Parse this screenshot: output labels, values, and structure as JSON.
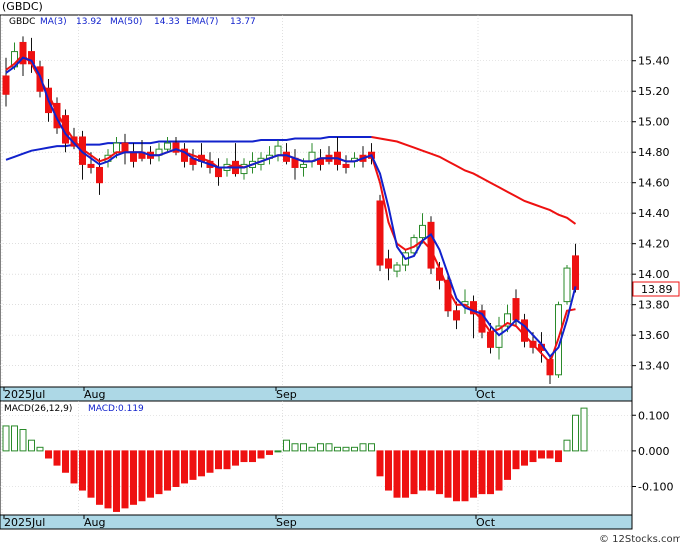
{
  "header": {
    "ticker": "(GBDC)",
    "symbol": "GBDC",
    "ma3_label": "MA(3)",
    "ma3_value": "13.92",
    "ma50_label": "MA(50)",
    "ma50_value": "14.33",
    "ema7_label": "EMA(7)",
    "ema7_value": "13.77"
  },
  "last_price_badge": "13.89",
  "macd_header": {
    "label": "MACD(26,12,9)",
    "value_label": "MACD:0.119"
  },
  "watermark": "© 12Stocks.com",
  "colors": {
    "up": "#2a8a2a",
    "down": "#ee1111",
    "ma_blue": "#1122cc",
    "ma_red": "#ee1111",
    "axis_band": "#add8e6",
    "grid": "#cccccc",
    "badge_border": "#ee1111"
  },
  "chart_data": [
    {
      "type": "candlestick",
      "title": "(GBDC)",
      "x_labels": [
        "2025Jul",
        "Aug",
        "Sep",
        "Oct"
      ],
      "y_ticks": [
        "15.40",
        "15.20",
        "15.00",
        "14.80",
        "14.60",
        "14.40",
        "14.20",
        "14.00",
        "13.80",
        "13.60",
        "13.40"
      ],
      "ylim": [
        13.26,
        15.7
      ],
      "grid": true,
      "candles": [
        [
          15.3,
          15.42,
          15.18,
          15.1
        ],
        [
          15.36,
          15.52,
          15.46,
          15.34
        ],
        [
          15.52,
          15.56,
          15.38,
          15.3
        ],
        [
          15.46,
          15.55,
          15.38,
          15.32
        ],
        [
          15.36,
          15.4,
          15.2,
          15.16
        ],
        [
          15.22,
          15.28,
          15.06,
          15.0
        ],
        [
          15.12,
          15.16,
          14.96,
          14.92
        ],
        [
          15.04,
          15.08,
          14.86,
          14.8
        ],
        [
          14.9,
          14.96,
          14.84,
          14.82
        ],
        [
          14.9,
          14.94,
          14.72,
          14.62
        ],
        [
          14.72,
          14.8,
          14.7,
          14.66
        ],
        [
          14.7,
          14.76,
          14.6,
          14.52
        ],
        [
          14.74,
          14.82,
          14.78,
          14.7
        ],
        [
          14.8,
          14.9,
          14.86,
          14.76
        ],
        [
          14.86,
          14.92,
          14.8,
          14.72
        ],
        [
          14.8,
          14.86,
          14.74,
          14.7
        ],
        [
          14.8,
          14.88,
          14.76,
          14.74
        ],
        [
          14.8,
          14.84,
          14.76,
          14.72
        ],
        [
          14.78,
          14.86,
          14.82,
          14.74
        ],
        [
          14.82,
          14.9,
          14.86,
          14.8
        ],
        [
          14.86,
          14.9,
          14.8,
          14.78
        ],
        [
          14.82,
          14.86,
          14.74,
          14.7
        ],
        [
          14.76,
          14.82,
          14.72,
          14.68
        ],
        [
          14.78,
          14.86,
          14.74,
          14.7
        ],
        [
          14.74,
          14.8,
          14.7,
          14.66
        ],
        [
          14.7,
          14.76,
          14.64,
          14.58
        ],
        [
          14.68,
          14.76,
          14.72,
          14.64
        ],
        [
          14.74,
          14.86,
          14.66,
          14.64
        ],
        [
          14.66,
          14.76,
          14.72,
          14.62
        ],
        [
          14.7,
          14.8,
          14.74,
          14.66
        ],
        [
          14.72,
          14.8,
          14.76,
          14.68
        ],
        [
          14.76,
          14.84,
          14.78,
          14.72
        ],
        [
          14.78,
          14.88,
          14.84,
          14.74
        ],
        [
          14.8,
          14.86,
          14.74,
          14.72
        ],
        [
          14.76,
          14.82,
          14.7,
          14.62
        ],
        [
          14.7,
          14.76,
          14.72,
          14.64
        ],
        [
          14.74,
          14.86,
          14.8,
          14.7
        ],
        [
          14.76,
          14.82,
          14.72,
          14.68
        ],
        [
          14.78,
          14.84,
          14.74,
          14.72
        ],
        [
          14.8,
          14.9,
          14.72,
          14.68
        ],
        [
          14.72,
          14.78,
          14.7,
          14.66
        ],
        [
          14.74,
          14.8,
          14.76,
          14.7
        ],
        [
          14.78,
          14.84,
          14.74,
          14.7
        ],
        [
          14.8,
          14.86,
          14.76,
          14.72
        ],
        [
          14.48,
          14.52,
          14.06,
          14.02
        ],
        [
          14.1,
          14.16,
          14.04,
          13.96
        ],
        [
          14.02,
          14.08,
          14.06,
          13.98
        ],
        [
          14.06,
          14.16,
          14.14,
          14.02
        ],
        [
          14.14,
          14.26,
          14.24,
          14.12
        ],
        [
          14.24,
          14.4,
          14.32,
          14.2
        ],
        [
          14.34,
          14.38,
          14.04,
          14.0
        ],
        [
          14.04,
          14.08,
          13.96,
          13.9
        ],
        [
          13.96,
          14.0,
          13.76,
          13.72
        ],
        [
          13.76,
          13.82,
          13.7,
          13.64
        ],
        [
          13.8,
          13.9,
          13.82,
          13.74
        ],
        [
          13.82,
          13.86,
          13.74,
          13.58
        ],
        [
          13.76,
          13.8,
          13.62,
          13.58
        ],
        [
          13.62,
          13.68,
          13.52,
          13.48
        ],
        [
          13.52,
          13.72,
          13.66,
          13.44
        ],
        [
          13.66,
          13.8,
          13.74,
          13.62
        ],
        [
          13.84,
          13.9,
          13.7,
          13.66
        ],
        [
          13.7,
          13.74,
          13.56,
          13.52
        ],
        [
          13.56,
          13.62,
          13.52,
          13.48
        ],
        [
          13.54,
          13.62,
          13.5,
          13.42
        ],
        [
          13.44,
          13.46,
          13.34,
          13.28
        ],
        [
          13.34,
          13.82,
          13.8,
          13.32
        ],
        [
          13.82,
          14.06,
          14.04,
          13.8
        ],
        [
          14.12,
          14.2,
          13.9,
          13.88
        ]
      ],
      "ma3": [
        15.32,
        15.36,
        15.42,
        15.4,
        15.3,
        15.14,
        15.02,
        14.92,
        14.86,
        14.8,
        14.76,
        14.72,
        14.74,
        14.78,
        14.8,
        14.8,
        14.8,
        14.78,
        14.78,
        14.8,
        14.82,
        14.8,
        14.76,
        14.74,
        14.72,
        14.7,
        14.7,
        14.7,
        14.7,
        14.72,
        14.74,
        14.76,
        14.78,
        14.78,
        14.76,
        14.74,
        14.74,
        14.76,
        14.76,
        14.76,
        14.74,
        14.74,
        14.76,
        14.78,
        14.66,
        14.44,
        14.18,
        14.1,
        14.12,
        14.22,
        14.26,
        14.16,
        14.0,
        13.84,
        13.78,
        13.76,
        13.74,
        13.66,
        13.6,
        13.64,
        13.7,
        13.66,
        13.6,
        13.54,
        13.46,
        13.52,
        13.7,
        13.92
      ],
      "ma50": [
        14.75,
        14.77,
        14.79,
        14.81,
        14.82,
        14.83,
        14.84,
        14.84,
        14.85,
        14.85,
        14.85,
        14.85,
        14.86,
        14.86,
        14.86,
        14.86,
        14.86,
        14.86,
        14.87,
        14.87,
        14.87,
        14.87,
        14.87,
        14.87,
        14.87,
        14.87,
        14.87,
        14.87,
        14.87,
        14.87,
        14.88,
        14.88,
        14.88,
        14.88,
        14.89,
        14.89,
        14.89,
        14.89,
        14.9,
        14.9,
        14.9,
        14.9,
        14.9,
        14.9,
        14.89,
        14.88,
        14.87,
        14.85,
        14.83,
        14.81,
        14.79,
        14.77,
        14.74,
        14.71,
        14.68,
        14.66,
        14.63,
        14.6,
        14.57,
        14.54,
        14.51,
        14.48,
        14.46,
        14.44,
        14.42,
        14.39,
        14.37,
        14.33
      ],
      "ema7": [
        15.34,
        15.38,
        15.44,
        15.38,
        15.28,
        15.18,
        15.06,
        14.96,
        14.88,
        14.82,
        14.78,
        14.74,
        14.76,
        14.8,
        14.8,
        14.8,
        14.8,
        14.78,
        14.78,
        14.8,
        14.82,
        14.8,
        14.78,
        14.76,
        14.74,
        14.7,
        14.7,
        14.72,
        14.7,
        14.72,
        14.74,
        14.76,
        14.78,
        14.78,
        14.76,
        14.74,
        14.74,
        14.76,
        14.76,
        14.76,
        14.74,
        14.74,
        14.76,
        14.78,
        14.6,
        14.34,
        14.2,
        14.16,
        14.18,
        14.22,
        14.16,
        14.04,
        13.9,
        13.8,
        13.8,
        13.76,
        13.7,
        13.62,
        13.64,
        13.68,
        13.66,
        13.6,
        13.54,
        13.48,
        13.42,
        13.58,
        13.76,
        13.77
      ],
      "last_value": 13.89
    },
    {
      "type": "bar",
      "title": "MACD(26,12,9)",
      "series_name": "MACD",
      "last_value_label": "MACD:0.119",
      "y_ticks": [
        "0.100",
        "0.000",
        "-0.100"
      ],
      "ylim": [
        -0.18,
        0.14
      ],
      "x_labels": [
        "2025Jul",
        "Aug",
        "Sep",
        "Oct"
      ],
      "values": [
        0.07,
        0.07,
        0.06,
        0.03,
        0.01,
        -0.02,
        -0.04,
        -0.06,
        -0.09,
        -0.11,
        -0.13,
        -0.15,
        -0.16,
        -0.17,
        -0.16,
        -0.15,
        -0.14,
        -0.13,
        -0.12,
        -0.11,
        -0.1,
        -0.09,
        -0.08,
        -0.07,
        -0.06,
        -0.05,
        -0.05,
        -0.04,
        -0.03,
        -0.03,
        -0.02,
        -0.01,
        0.0,
        0.03,
        0.02,
        0.02,
        0.01,
        0.02,
        0.02,
        0.01,
        0.01,
        0.01,
        0.02,
        0.02,
        -0.07,
        -0.11,
        -0.13,
        -0.13,
        -0.12,
        -0.11,
        -0.11,
        -0.12,
        -0.13,
        -0.14,
        -0.14,
        -0.13,
        -0.12,
        -0.12,
        -0.11,
        -0.08,
        -0.05,
        -0.04,
        -0.03,
        -0.02,
        -0.02,
        -0.03,
        0.03,
        0.1,
        0.12
      ]
    }
  ]
}
